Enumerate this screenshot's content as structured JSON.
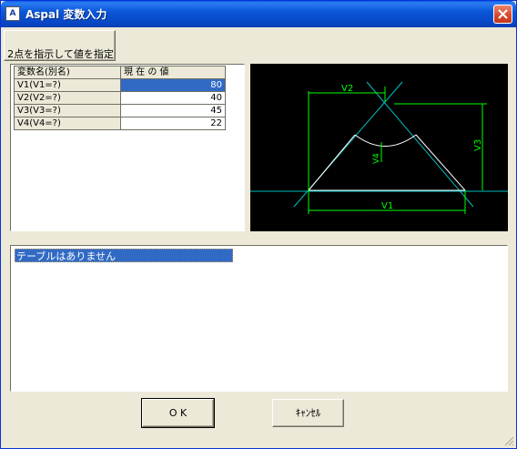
{
  "window": {
    "title": "Aspal 変数入力",
    "icon_label": "A"
  },
  "toolbar": {
    "pick_points_label": "2点を指示して値を指定"
  },
  "variables": {
    "headers": [
      "変数名(別名)",
      "現 在 の 値"
    ],
    "rows": [
      {
        "name": "V1(V1=?)",
        "value": "80",
        "selected": true
      },
      {
        "name": "V2(V2=?)",
        "value": "40",
        "selected": false
      },
      {
        "name": "V3(V3=?)",
        "value": "45",
        "selected": false
      },
      {
        "name": "V4(V4=?)",
        "value": "22",
        "selected": false
      }
    ]
  },
  "diagram": {
    "labels": {
      "v1": "V1",
      "v2": "V2",
      "v3": "V3",
      "v4": "V4"
    },
    "colors": {
      "line": "#ffffff",
      "dimension": "#00ff00",
      "construction": "#00c0c0"
    }
  },
  "messages": {
    "items": [
      "テーブルはありません"
    ]
  },
  "dialog": {
    "ok_label": "O K",
    "cancel_label": "ｷｬﾝｾﾙ"
  },
  "colors": {
    "titlebar": "#0a57d8",
    "selection": "#316ac5",
    "face": "#ece9d8"
  }
}
